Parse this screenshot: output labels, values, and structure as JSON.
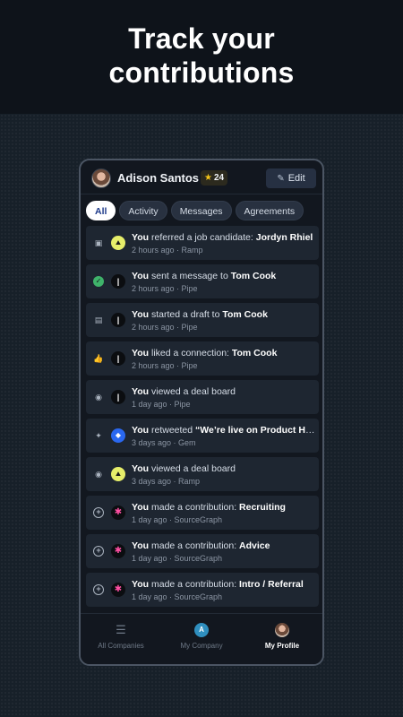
{
  "hero": {
    "title_line1": "Track your",
    "title_line2": "contributions"
  },
  "header": {
    "name": "Adison Santos",
    "star_count": "24",
    "edit_label": "Edit"
  },
  "tabs": [
    {
      "label": "All",
      "active": true
    },
    {
      "label": "Activity"
    },
    {
      "label": "Messages"
    },
    {
      "label": "Agreements"
    }
  ],
  "feed": [
    {
      "type_icon": "briefcase-icon",
      "logo": "ramp",
      "you": "You",
      "action": " referred a job candidate: ",
      "target": "Jordyn Rhiel",
      "meta": "2 hours ago · Ramp"
    },
    {
      "type_icon": "check-circle-icon",
      "logo": "pipe",
      "you": "You",
      "action": " sent a message to ",
      "target": "Tom Cook",
      "meta": "2 hours ago · Pipe"
    },
    {
      "type_icon": "document-icon",
      "logo": "pipe",
      "you": "You",
      "action": " started a draft to ",
      "target": "Tom Cook",
      "meta": "2 hours ago · Pipe"
    },
    {
      "type_icon": "thumbs-up-icon",
      "logo": "pipe",
      "you": "You",
      "action": " liked a connection: ",
      "target": "Tom Cook",
      "meta": "2 hours ago · Pipe"
    },
    {
      "type_icon": "eye-icon",
      "logo": "pipe",
      "you": "You",
      "action": " viewed a deal board",
      "target": "",
      "meta": "1 day ago · Pipe"
    },
    {
      "type_icon": "twitter-icon",
      "logo": "gem",
      "you": "You",
      "action": " retweeted ",
      "target": "“We’re live on Product Hun...",
      "meta": "3 days ago · Gem"
    },
    {
      "type_icon": "eye-icon",
      "logo": "ramp",
      "you": "You",
      "action": " viewed a deal board",
      "target": "",
      "meta": "3 days ago · Ramp"
    },
    {
      "type_icon": "plus-circle-icon",
      "logo": "sg",
      "you": "You",
      "action": " made a contribution: ",
      "target": "Recruiting",
      "meta": "1 day ago · SourceGraph"
    },
    {
      "type_icon": "plus-circle-icon",
      "logo": "sg",
      "you": "You",
      "action": " made a contribution: ",
      "target": "Advice",
      "meta": "1 day ago · SourceGraph"
    },
    {
      "type_icon": "plus-circle-icon",
      "logo": "sg",
      "you": "You",
      "action": " made a contribution: ",
      "target": "Intro / Referral",
      "meta": "1 day ago · SourceGraph"
    }
  ],
  "nav": [
    {
      "label": "All Companies",
      "icon": "list-icon"
    },
    {
      "label": "My Company",
      "icon": "company-logo-icon",
      "glyph": "A"
    },
    {
      "label": "My Profile",
      "icon": "profile-avatar-icon",
      "active": true
    }
  ],
  "colors": {
    "accent_star": "#f5c518",
    "success": "#3fb36a",
    "ramp": "#e6ee6a",
    "gem": "#2a68f0"
  }
}
